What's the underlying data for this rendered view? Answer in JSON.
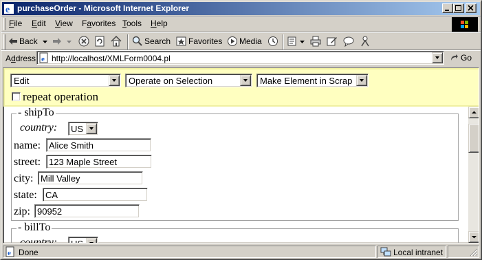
{
  "window": {
    "title": "purchaseOrder - Microsoft Internet Explorer",
    "buttons": {
      "minimize": "_",
      "maximize": "□",
      "close": "✕"
    }
  },
  "menu": [
    {
      "accel": "F",
      "rest": "ile"
    },
    {
      "accel": "E",
      "rest": "dit"
    },
    {
      "accel": "V",
      "rest": "iew"
    },
    {
      "pre": "F",
      "accel": "a",
      "rest": "vorites"
    },
    {
      "accel": "T",
      "rest": "ools"
    },
    {
      "accel": "H",
      "rest": "elp"
    }
  ],
  "toolbar": {
    "back": "Back",
    "search": "Search",
    "favorites": "Favorites",
    "media": "Media"
  },
  "address": {
    "label_accel": "d",
    "label_pre": "A",
    "label_rest": "dress",
    "url": "http://localhost/XMLForm0004.pl",
    "go": "Go"
  },
  "form_controls": {
    "edit_select": "Edit",
    "operate_select": "Operate on Selection",
    "make_select": "Make Element in Scrap",
    "repeat_label": "repeat operation"
  },
  "shipTo": {
    "legend": "- shipTo",
    "country_label": "country:",
    "country_value": "US",
    "name_label": "name:",
    "name_value": "Alice Smith",
    "street_label": "street:",
    "street_value": "123 Maple Street",
    "city_label": "city:",
    "city_value": "Mill Valley",
    "state_label": "state:",
    "state_value": "CA",
    "zip_label": "zip:",
    "zip_value": "90952"
  },
  "billTo": {
    "legend": "- billTo",
    "country_label": "country:",
    "country_value": "US"
  },
  "status": {
    "text": "Done",
    "zone": "Local intranet"
  }
}
